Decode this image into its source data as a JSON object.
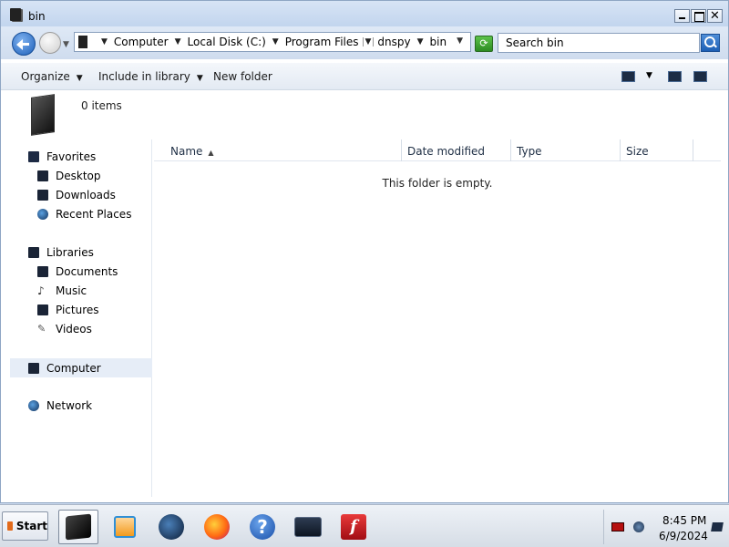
{
  "window": {
    "title": "bin"
  },
  "address": {
    "crumbs": [
      "Computer",
      "Local Disk (C:)",
      "Program Files",
      "dnspy",
      "bin"
    ]
  },
  "search": {
    "placeholder": "Search bin"
  },
  "commands": {
    "organize": "Organize",
    "include_in_library": "Include in library",
    "new_folder": "New folder"
  },
  "info": {
    "items_count": "0 items"
  },
  "nav": {
    "favorites": "Favorites",
    "desktop": "Desktop",
    "downloads": "Downloads",
    "recent_places": "Recent Places",
    "libraries": "Libraries",
    "documents": "Documents",
    "music": "Music",
    "pictures": "Pictures",
    "videos": "Videos",
    "computer": "Computer",
    "network": "Network"
  },
  "columns": {
    "name": "Name",
    "date_modified": "Date modified",
    "type": "Type",
    "size": "Size"
  },
  "content": {
    "empty_message": "This folder is empty."
  },
  "taskbar": {
    "start": "Start",
    "time": "8:45 PM",
    "date": "6/9/2024"
  },
  "colors": {
    "titlebar": "#c2d5ee",
    "selection": "#e6edf7",
    "refresh": "#2c8c22",
    "flash": "#c1121f"
  },
  "icons": {
    "back": "back-arrow-icon",
    "forward": "forward-arrow-icon",
    "refresh": "refresh-icon",
    "search": "magnifier-icon"
  }
}
